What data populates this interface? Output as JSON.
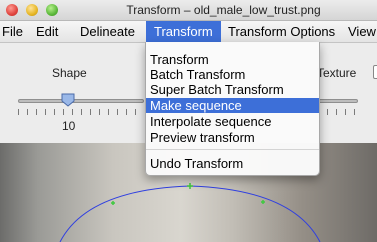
{
  "window": {
    "title": "Transform – old_male_low_trust.png"
  },
  "menubar": {
    "items": [
      "File",
      "Edit",
      "Delineate",
      "Transform",
      "Transform Options",
      "View"
    ],
    "active_index": 3
  },
  "toolbar": {
    "shape_label": "Shape",
    "shape_value": "10",
    "texture_label": "Texture"
  },
  "transform_menu": {
    "items": [
      "Transform",
      "Batch Transform",
      "Super Batch Transform",
      "Make sequence",
      "Interpolate sequence",
      "Preview transform"
    ],
    "selected_index": 3,
    "undo_label": "Undo Transform"
  },
  "colors": {
    "accent": "#3d6fd8",
    "template_line": "#2f3fe0",
    "template_point": "#3fc93f"
  }
}
